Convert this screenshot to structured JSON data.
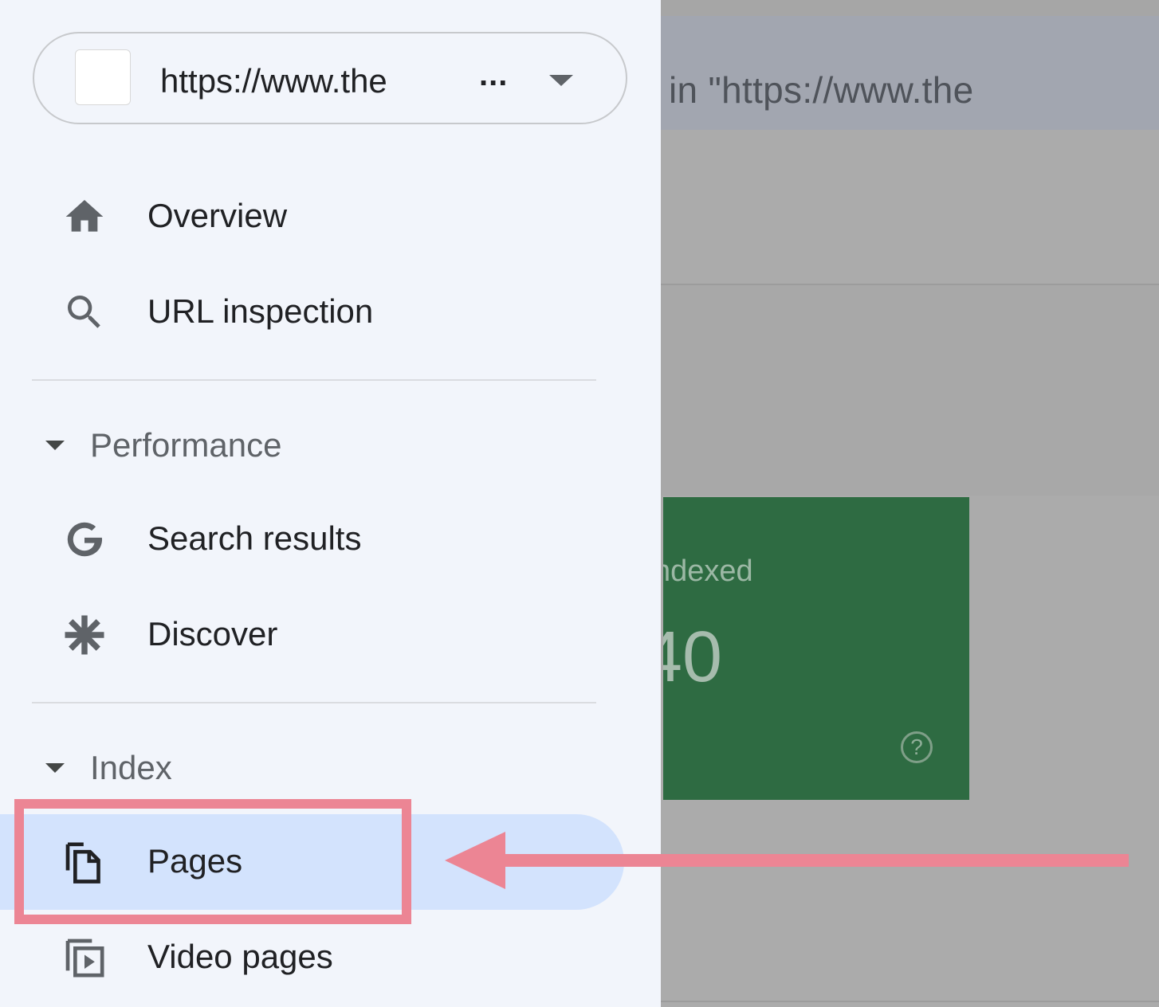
{
  "property_selector": {
    "url": "https://www.the",
    "ellipsis": "..."
  },
  "nav": {
    "overview": {
      "label": "Overview",
      "icon": "home-icon"
    },
    "url_inspection": {
      "label": "URL inspection",
      "icon": "search-icon"
    }
  },
  "performance": {
    "header": "Performance",
    "items": [
      {
        "label": "Search results",
        "icon": "google-g-icon"
      },
      {
        "label": "Discover",
        "icon": "asterisk-icon"
      }
    ]
  },
  "index": {
    "header": "Index",
    "items": [
      {
        "label": "Pages",
        "icon": "pages-icon",
        "active": true
      },
      {
        "label": "Video pages",
        "icon": "video-pages-icon"
      }
    ]
  },
  "main": {
    "search_text": "in \"https://www.the",
    "indexed_card": {
      "label": "ndexed",
      "value": "40",
      "color": "#2e6b42"
    }
  },
  "colors": {
    "sidebar_bg": "#f2f5fb",
    "active_item_bg": "#d3e3fd",
    "annotation": "#ec8594"
  }
}
